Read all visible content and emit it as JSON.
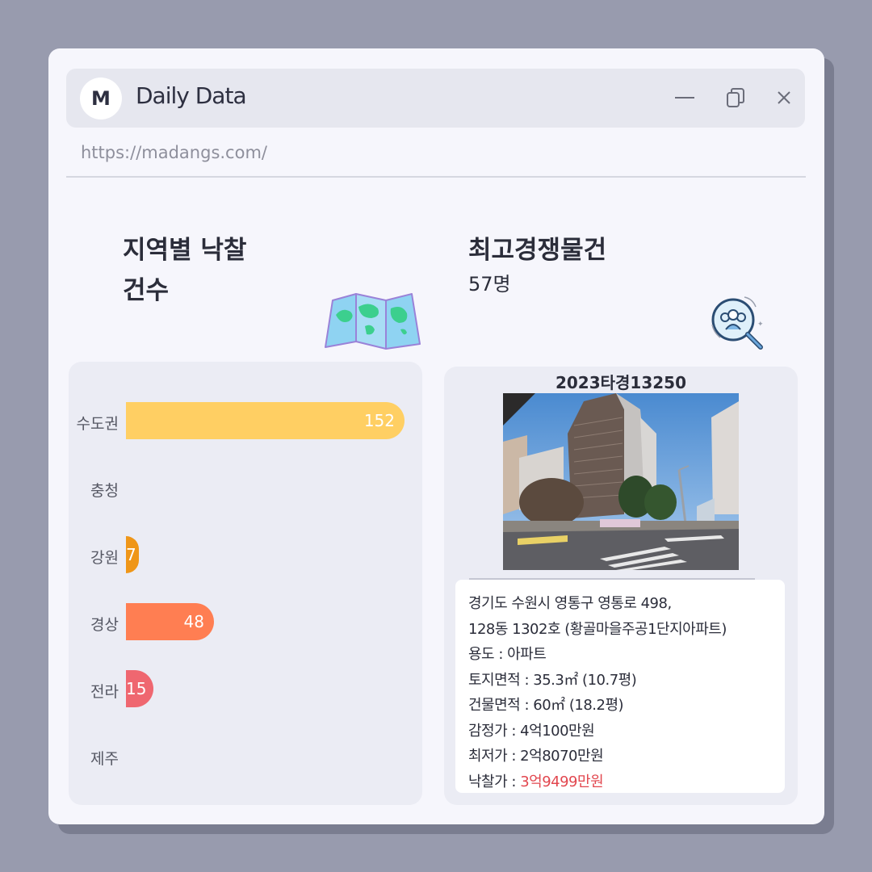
{
  "window": {
    "logo_letter": "M",
    "title": "Daily Data",
    "url": "https://madangs.com/",
    "controls": [
      "minimize-icon",
      "restore-icon",
      "close-icon"
    ]
  },
  "left_section": {
    "heading_line1": "지역별 낙찰",
    "heading_line2": "건수",
    "icon": "folded-map-icon"
  },
  "right_section": {
    "heading": "최고경쟁물건",
    "count": "57명",
    "icon": "people-search-icon"
  },
  "chart_data": {
    "type": "bar",
    "orientation": "horizontal",
    "categories": [
      "수도권",
      "충청",
      "강원",
      "경상",
      "전라",
      "제주"
    ],
    "values": [
      152,
      0,
      7,
      48,
      15,
      0
    ],
    "labels": [
      "152",
      "",
      "7",
      "48",
      "15",
      ""
    ],
    "colors": [
      "#ffcf63",
      "#ffcf63",
      "#ef9618",
      "#ff7e52",
      "#ef6770",
      "#ef6770"
    ],
    "xlim": [
      0,
      152
    ]
  },
  "property": {
    "case_number": "2023타경13250",
    "address_line1": "경기도 수원시 영통구 영통로 498,",
    "address_line2": "128동 1302호 (황골마을주공1단지아파트)",
    "usage": "용도 : 아파트",
    "land_area": "토지면적 : 35.3㎡ (10.7평)",
    "building_area": "건물면적 : 60㎡ (18.2평)",
    "appraisal": "감정가 : 4억100만원",
    "minimum": "최저가 : 2억8070만원",
    "winning_label": "낙찰가 : ",
    "winning_value": "3억9499만원"
  }
}
